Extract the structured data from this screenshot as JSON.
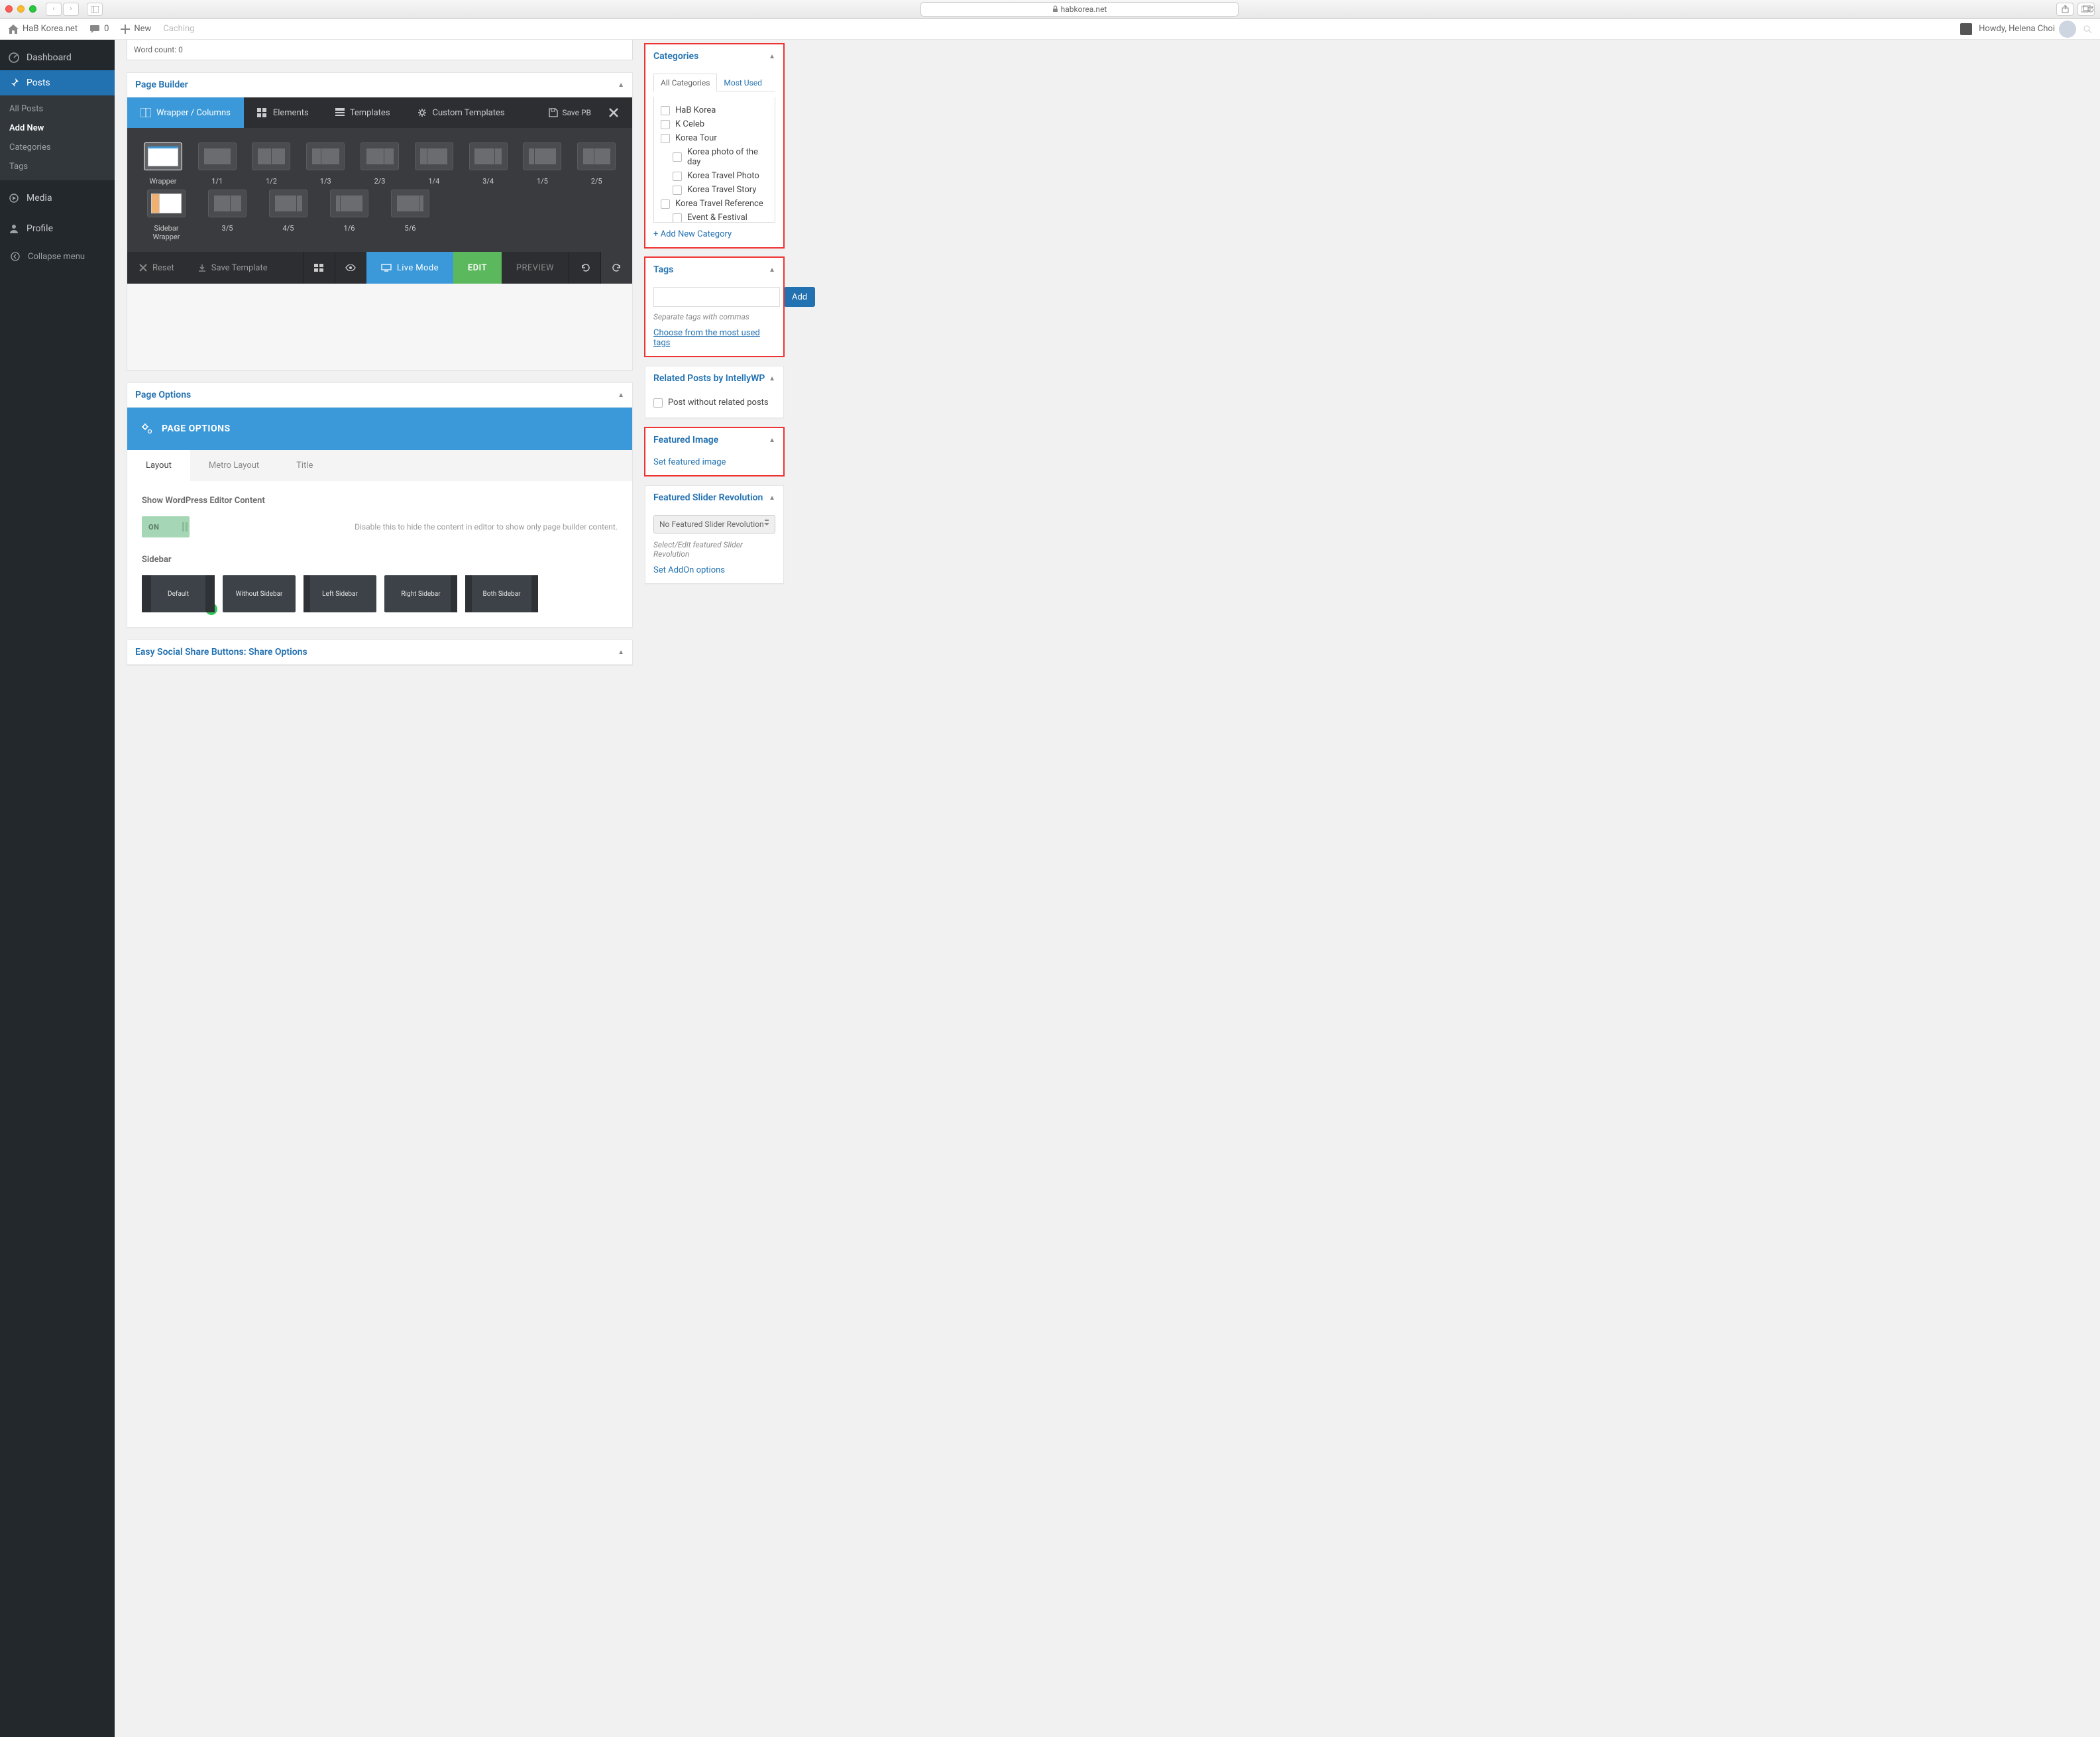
{
  "browser": {
    "url": "habkorea.net"
  },
  "adminbar": {
    "site": "HaB Korea.net",
    "comments": "0",
    "new": "New",
    "caching": "Caching",
    "howdy": "Howdy, Helena Choi"
  },
  "sidebar": {
    "items": [
      {
        "label": "Dashboard"
      },
      {
        "label": "Posts"
      },
      {
        "label": "Media"
      },
      {
        "label": "Profile"
      }
    ],
    "sub": [
      {
        "label": "All Posts"
      },
      {
        "label": "Add New"
      },
      {
        "label": "Categories"
      },
      {
        "label": "Tags"
      }
    ],
    "collapse": "Collapse menu"
  },
  "wordcount": {
    "label": "Word count: 0"
  },
  "pagebuilder": {
    "title": "Page Builder",
    "tabs": {
      "wrapper": "Wrapper / Columns",
      "elements": "Elements",
      "templates": "Templates",
      "custom": "Custom Templates"
    },
    "save": "Save PB",
    "blocks_row1": [
      "Wrapper",
      "1/1",
      "1/2",
      "1/3",
      "2/3",
      "1/4",
      "3/4",
      "1/5",
      "2/5"
    ],
    "blocks_row2": [
      "Sidebar Wrapper",
      "3/5",
      "4/5",
      "1/6",
      "5/6"
    ],
    "footer": {
      "reset": "Reset",
      "savetpl": "Save Template",
      "live": "Live Mode",
      "edit": "EDIT",
      "preview": "PREVIEW"
    }
  },
  "pageoptions": {
    "title": "Page Options",
    "hero": "PAGE OPTIONS",
    "tabs": {
      "layout": "Layout",
      "metro": "Metro Layout",
      "title": "Title"
    },
    "showeditor": "Show WordPress Editor Content",
    "showeditor_hint": "Disable this to hide the content in editor to show only page builder content.",
    "toggle_on": "ON",
    "sidebar_label": "Sidebar",
    "sidebar_opts": [
      "Default",
      "Without Sidebar",
      "Left Sidebar",
      "Right Sidebar",
      "Both Sidebar"
    ]
  },
  "easysocial": {
    "title": "Easy Social Share Buttons: Share Options"
  },
  "meta": {
    "categories": {
      "title": "Categories",
      "tab_all": "All Categories",
      "tab_most": "Most Used",
      "items": [
        {
          "label": "HaB Korea",
          "indent": false
        },
        {
          "label": "K Celeb",
          "indent": false
        },
        {
          "label": "Korea Tour",
          "indent": false
        },
        {
          "label": "Korea photo of the day",
          "indent": true
        },
        {
          "label": "Korea Travel Photo",
          "indent": true
        },
        {
          "label": "Korea Travel Story",
          "indent": true
        },
        {
          "label": "Korea Travel Reference",
          "indent": false
        },
        {
          "label": "Event & Festival",
          "indent": true
        }
      ],
      "add": "+ Add New Category"
    },
    "tags": {
      "title": "Tags",
      "add": "Add",
      "hint": "Separate tags with commas",
      "choose": "Choose from the most used tags"
    },
    "related": {
      "title": "Related Posts by IntellyWP",
      "checkbox": "Post without related posts"
    },
    "featured": {
      "title": "Featured Image",
      "set": "Set featured image"
    },
    "slider": {
      "title": "Featured Slider Revolution",
      "selected": "No Featured Slider Revolution",
      "hint": "Select/Edit featured Slider Revolution",
      "addon": "Set AddOn options"
    }
  }
}
